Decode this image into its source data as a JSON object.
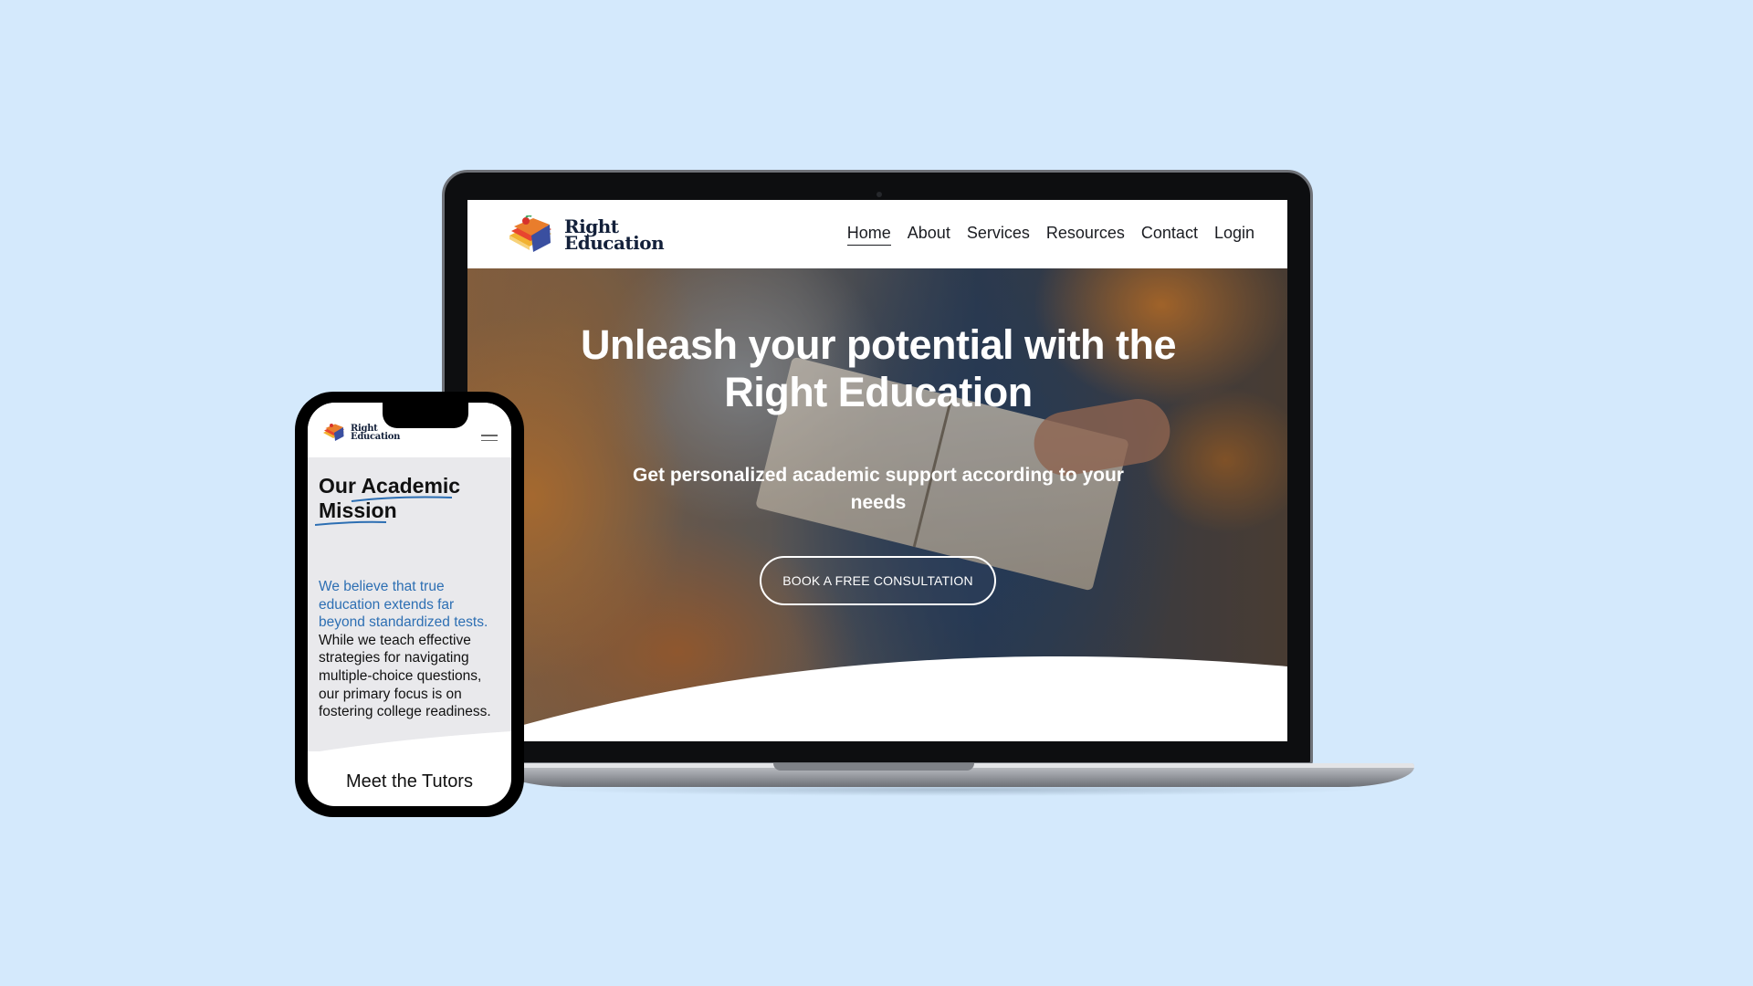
{
  "laptop": {
    "logo": {
      "line1": "Right",
      "line2": "Education"
    },
    "nav": [
      {
        "label": "Home",
        "active": true
      },
      {
        "label": "About"
      },
      {
        "label": "Services"
      },
      {
        "label": "Resources"
      },
      {
        "label": "Contact"
      },
      {
        "label": "Login"
      }
    ],
    "hero": {
      "title": "Unleash your potential with the Right Education",
      "subtitle": "Get personalized academic support according to your needs",
      "cta": "BOOK A FREE CONSULTATION"
    }
  },
  "phone": {
    "logo": {
      "line1": "Right",
      "line2": "Education"
    },
    "mission": {
      "title_plain": "Our ",
      "title_highlight": "Academic Mission",
      "body_highlight": "We believe that true education extends far beyond standardized tests.",
      "body_rest": " While we teach effective strategies for navigating multiple-choice questions, our primary focus is on fostering college readiness."
    },
    "next_section": "Meet the Tutors"
  },
  "colors": {
    "background": "#d4e9fc",
    "brand_navy": "#13203a",
    "link_blue": "#2d6fb3"
  }
}
